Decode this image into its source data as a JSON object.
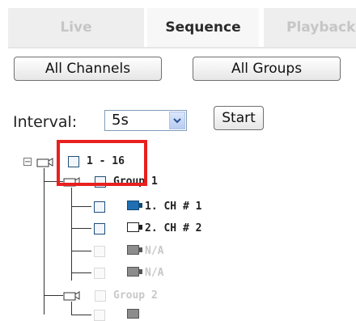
{
  "tabs": [
    {
      "label": "Live"
    },
    {
      "label": "Sequence"
    },
    {
      "label": "Playback"
    }
  ],
  "buttons": {
    "all_channels": "All Channels",
    "all_groups": "All Groups",
    "start": "Start"
  },
  "interval": {
    "label": "Interval:",
    "value": "5s"
  },
  "tree": {
    "root": {
      "expander": "−",
      "label": "1 - 16"
    },
    "group1": {
      "label": "Group 1"
    },
    "ch1": {
      "label": "1. CH # 1"
    },
    "ch2": {
      "label": "2. CH # 2"
    },
    "na1": {
      "label": "N/A"
    },
    "na2": {
      "label": "N/A"
    },
    "group2": {
      "label": "Group 2"
    }
  },
  "colors": {
    "highlight": "#e8201f",
    "active_camera": "#1f6fb2"
  }
}
